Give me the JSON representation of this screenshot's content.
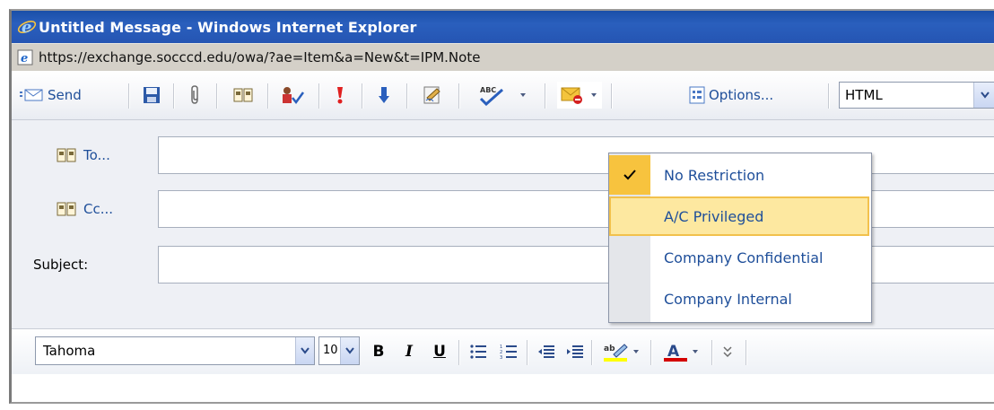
{
  "window": {
    "title": "Untitled Message - Windows Internet Explorer"
  },
  "address": {
    "url": "https://exchange.socccd.edu/owa/?ae=Item&a=New&t=IPM.Note"
  },
  "toolbar": {
    "send_label": "Send",
    "options_label": "Options...",
    "format_value": "HTML",
    "icons": [
      "save-icon",
      "attach-icon",
      "address-book-icon",
      "check-names-icon",
      "high-importance-icon",
      "low-importance-icon",
      "signature-icon",
      "spell-check-icon",
      "permission-icon",
      "options-icon"
    ]
  },
  "form": {
    "to_label": "To...",
    "cc_label": "Cc...",
    "subject_label": "Subject:",
    "to_value": "",
    "cc_value": "",
    "subject_value": ""
  },
  "format_bar": {
    "font": "Tahoma",
    "size": "10",
    "bold": "B",
    "italic": "I",
    "underline": "U"
  },
  "permission_menu": {
    "items": [
      {
        "label": "No Restriction",
        "checked": true
      },
      {
        "label": "A/C Privileged",
        "highlighted": true
      },
      {
        "label": "Company Confidential"
      },
      {
        "label": "Company Internal"
      }
    ]
  },
  "colors": {
    "title_bar": "#2555b3",
    "link": "#1f4f9a",
    "highlight": "#fde8a0",
    "check_bg": "#f7c33e",
    "font_color_bar": "#d40000",
    "highlight_bar": "#ffff00"
  }
}
